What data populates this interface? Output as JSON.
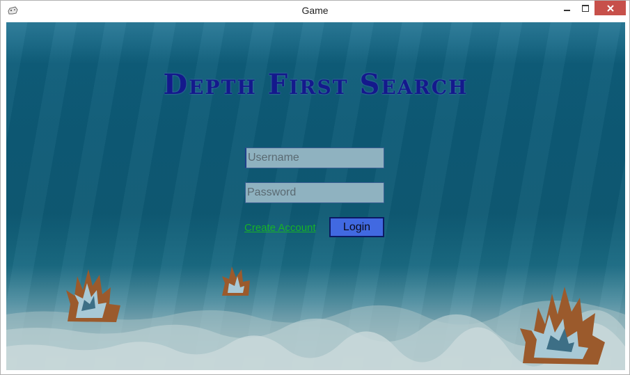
{
  "window": {
    "title": "Game",
    "app_icon": "gamepad-icon",
    "controls": [
      "minimize-icon",
      "maximize-icon",
      "close-icon"
    ]
  },
  "game": {
    "heading": "Depth First Search",
    "username": {
      "placeholder": "Username",
      "value": ""
    },
    "password": {
      "placeholder": "Password",
      "value": ""
    },
    "create_account_label": "Create Account",
    "login_label": "Login"
  },
  "colors": {
    "title_text": "#14198c",
    "link": "#17b327",
    "login_button": "#4169e1",
    "close_button": "#c7504a",
    "input_bg": "#8fb2c0"
  }
}
